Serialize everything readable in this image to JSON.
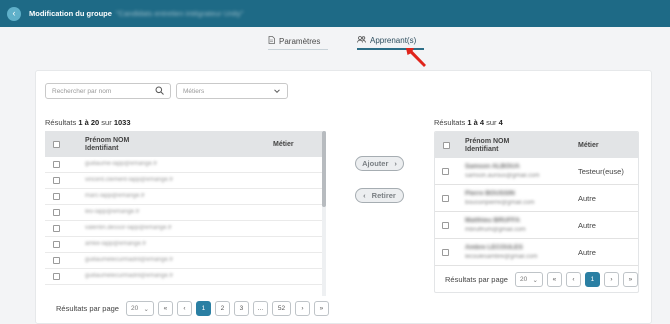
{
  "header": {
    "title": "Modification du groupe",
    "group_name": "\"Candidats entretien intégrateur Unity\""
  },
  "tabs": [
    {
      "label": "Paramètres",
      "icon": "document-icon"
    },
    {
      "label": "Apprenant(s)",
      "icon": "users-icon"
    }
  ],
  "filters": {
    "search_placeholder": "Rechercher par nom",
    "metier_placeholder": "Métiers"
  },
  "left": {
    "results_prefix": "Résultats ",
    "range": "1 à 20",
    "sur": " sur ",
    "total": "1033",
    "col_name": "Prénom NOM",
    "col_id": "Identifiant",
    "col_metier": "Métier",
    "rows": [
      "guillaume-lapp@emange.fr",
      "vincent.clement-lapp@emange.fr",
      "marc-lapp@emange.fr",
      "leo-lapp@emange.fr",
      "valentin.dessor-lapp@emange.fr",
      "amke-lapp@emange.fr",
      "guillaumelecurmadril@emange.fr",
      "guillaumelecurmadril@emange.fr"
    ],
    "pager": {
      "label": "Résultats par page",
      "per_page": "20",
      "pages": [
        "1",
        "2",
        "3",
        "...",
        "52"
      ],
      "active": "1"
    }
  },
  "actions": {
    "add_label": "Ajouter",
    "remove_label": "Retirer"
  },
  "right": {
    "results_prefix": "Résultats ",
    "range": "1 à 4",
    "sur": " sur ",
    "total": "4",
    "col_name": "Prénom NOM",
    "col_id": "Identifiant",
    "col_metier": "Métier",
    "rows": [
      {
        "name": "Samson ALBOUA",
        "email": "samson.aurous@gmail.com",
        "metier": "Testeur(euse)"
      },
      {
        "name": "Pierre BOUSSIN",
        "email": "boussinpierre@gmail.com",
        "metier": "Autre"
      },
      {
        "name": "Matthieu BRUFFA",
        "email": "mbruffrum@gmail.com",
        "metier": "Autre"
      },
      {
        "name": "Ambre LECOULES",
        "email": "lecoulesambre@gmail.com",
        "metier": "Autre"
      }
    ],
    "pager": {
      "label": "Résultats par page",
      "per_page": "20",
      "pages": [
        "1"
      ],
      "active": "1"
    }
  },
  "colors": {
    "header": "#1e6a86",
    "accent": "#2a7fa3",
    "arrow": "#e0241b"
  }
}
